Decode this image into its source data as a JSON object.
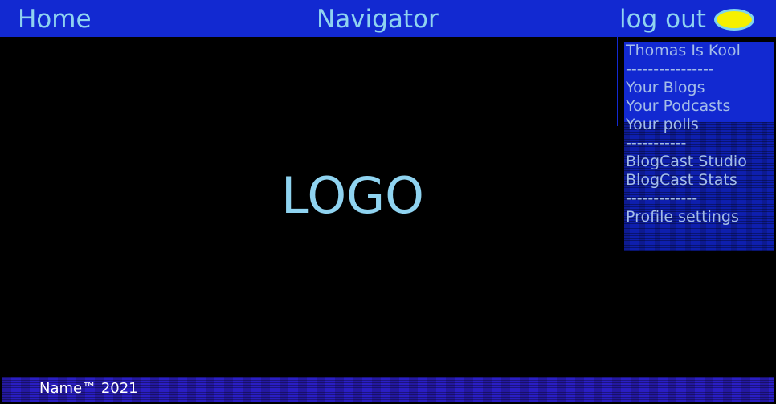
{
  "header": {
    "home_label": "Home",
    "title": "Navigator",
    "logout_label": "log out",
    "avatar_color": "#f6f000"
  },
  "user_menu": {
    "items": [
      "Thomas Is Kool",
      "----------------",
      "Your Blogs",
      "Your Podcasts",
      "Your polls",
      "-----------",
      "BlogCast Studio",
      "BlogCast Stats",
      "-------------",
      "Profile settings"
    ]
  },
  "main": {
    "logo_text": "LOGO"
  },
  "footer": {
    "text": "Name™ 2021"
  },
  "colors": {
    "bar": "#1229d1",
    "text": "#8fd3f0",
    "background": "#000000"
  }
}
